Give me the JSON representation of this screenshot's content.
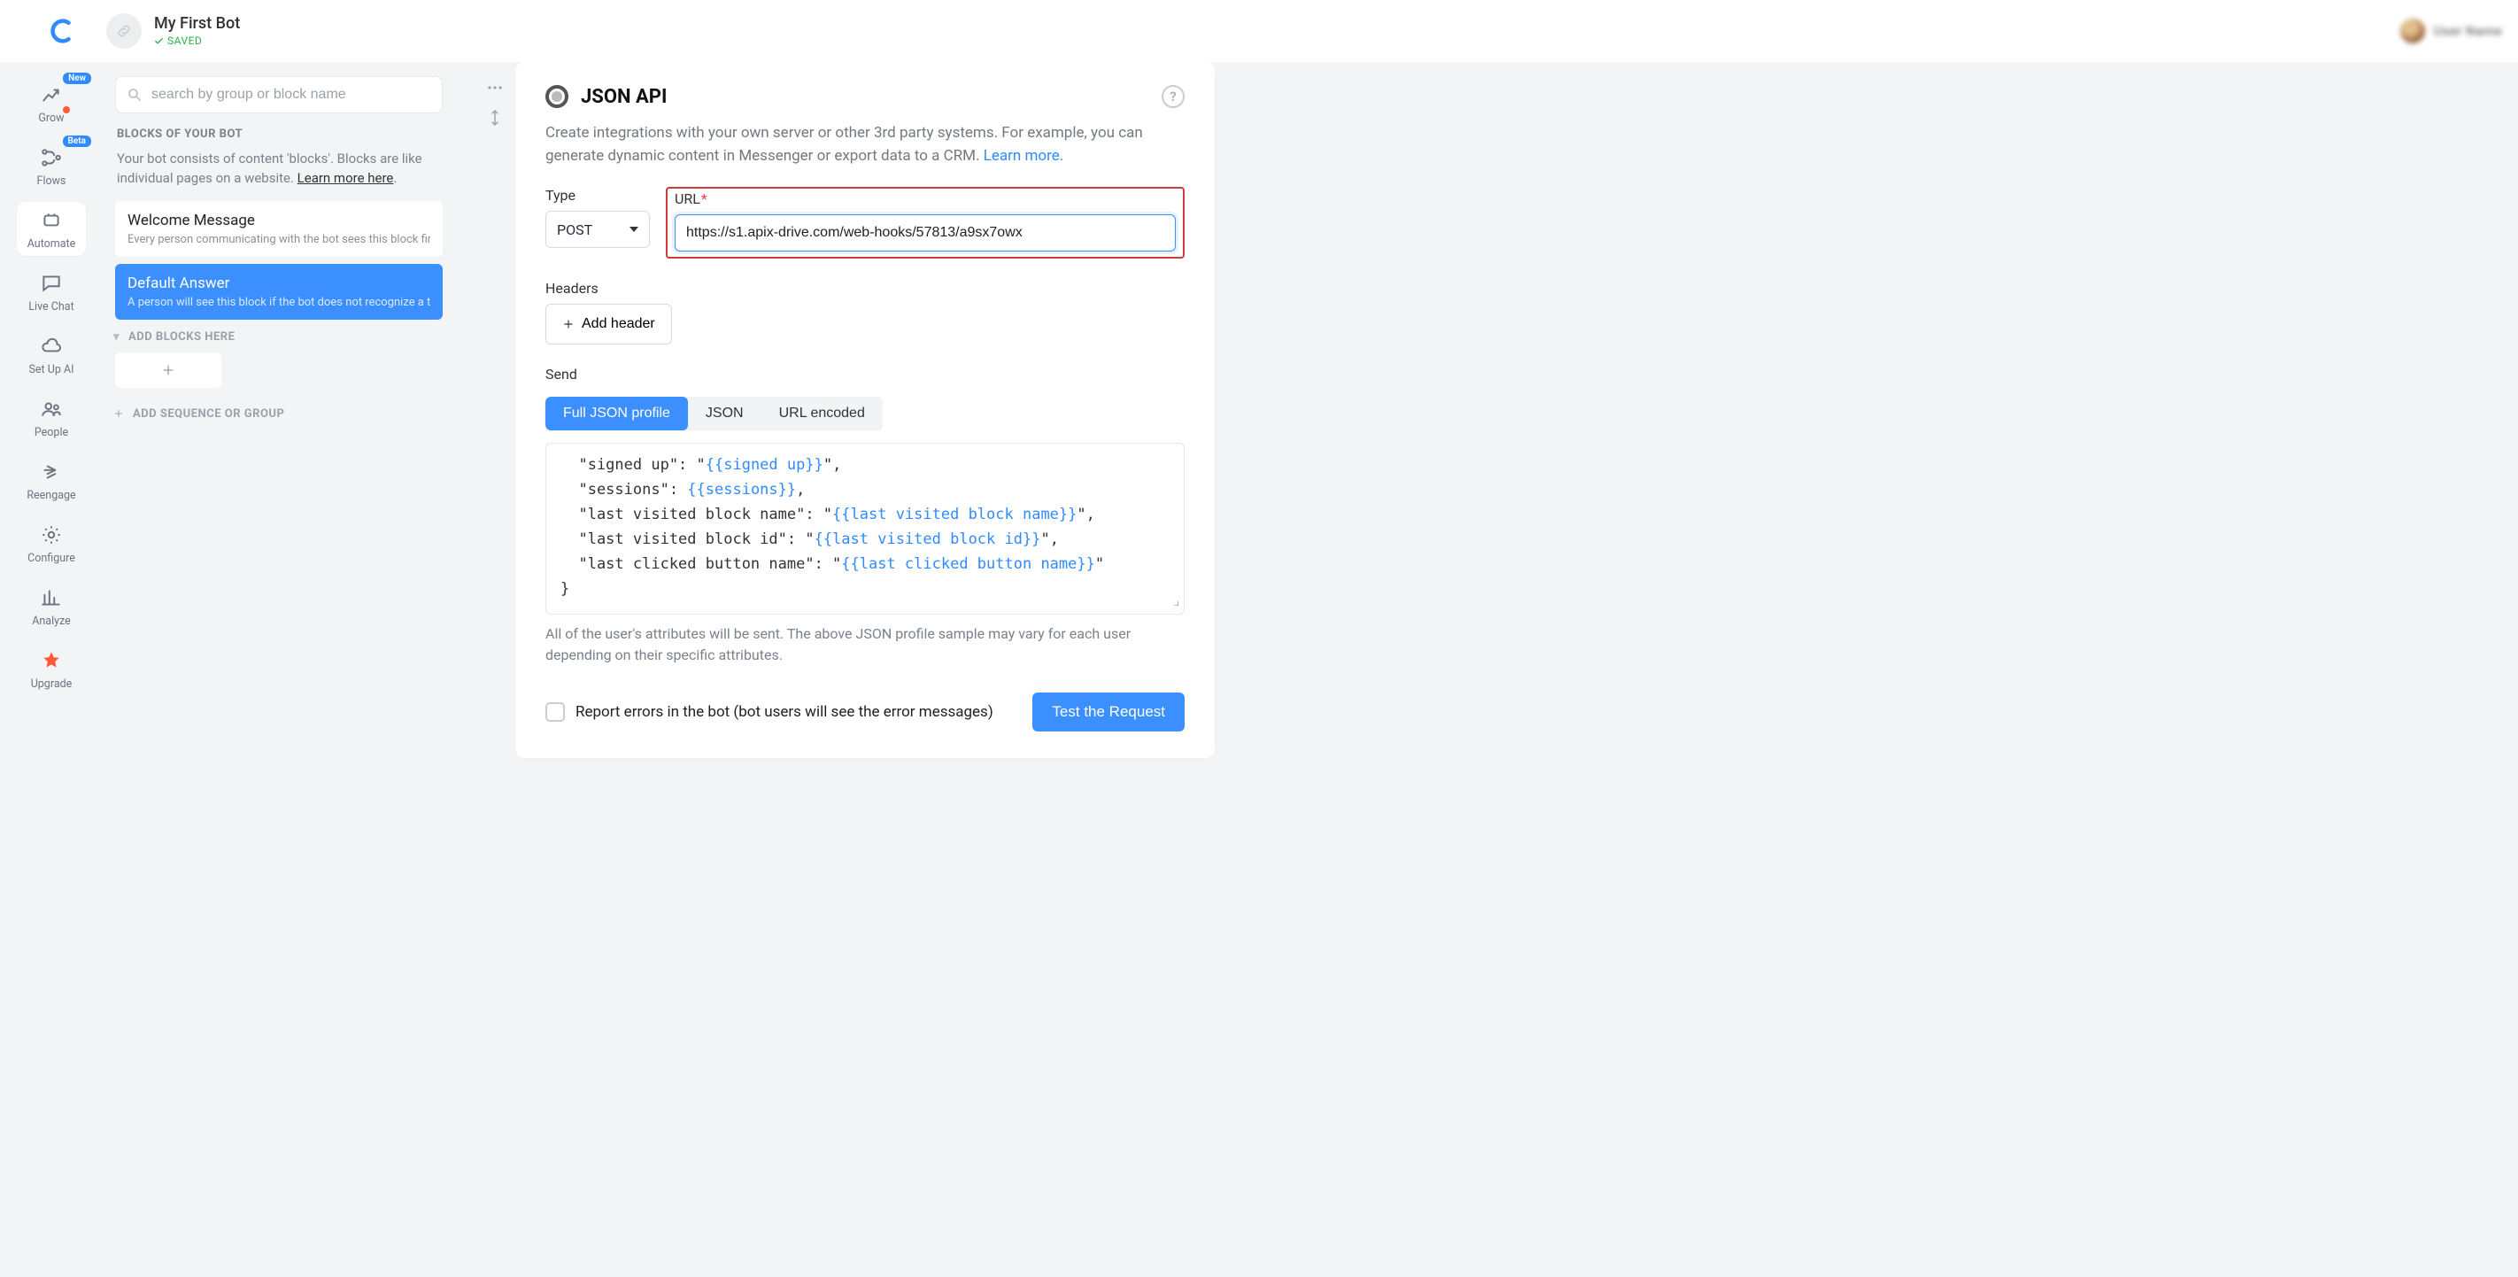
{
  "header": {
    "bot_name": "My First Bot",
    "saved_label": "SAVED",
    "user_name": "User Name"
  },
  "nav": {
    "grow": "Grow",
    "grow_badge": "New",
    "flows": "Flows",
    "flows_badge": "Beta",
    "automate": "Automate",
    "live_chat": "Live Chat",
    "set_up_ai": "Set Up AI",
    "people": "People",
    "reengage": "Reengage",
    "configure": "Configure",
    "analyze": "Analyze",
    "upgrade": "Upgrade"
  },
  "blocks": {
    "search_placeholder": "search by group or block name",
    "heading": "BLOCKS OF YOUR BOT",
    "desc_pre": "Your bot consists of content 'blocks'. Blocks are like individual pages on a website. ",
    "desc_link": "Learn more here",
    "welcome_title": "Welcome Message",
    "welcome_desc": "Every person communicating with the bot sees this block first",
    "default_title": "Default Answer",
    "default_desc": "A person will see this block if the bot does not recognize a text",
    "add_blocks": "ADD BLOCKS HERE",
    "add_sequence": "ADD SEQUENCE OR GROUP"
  },
  "panel": {
    "title": "JSON API",
    "desc": "Create integrations with your own server or other 3rd party systems. For example, you can generate dynamic content in Messenger or export data to a CRM.  ",
    "learn_more": "Learn more.",
    "type_label": "Type",
    "type_value": "POST",
    "url_label": "URL",
    "url_value": "https://s1.apix-drive.com/web-hooks/57813/a9sx7owx",
    "headers_label": "Headers",
    "add_header": "Add header",
    "send_label": "Send",
    "seg_full": "Full JSON profile",
    "seg_json": "JSON",
    "seg_urlenc": "URL encoded",
    "code_lines": [
      {
        "prefix": "  \"signed up\": \"",
        "token": "{{signed up}}",
        "suffix": "\","
      },
      {
        "prefix": "  \"sessions\": ",
        "token": "{{sessions}}",
        "suffix": ","
      },
      {
        "prefix": "  \"last visited block name\": \"",
        "token": "{{last visited block name}}",
        "suffix": "\","
      },
      {
        "prefix": "  \"last visited block id\": \"",
        "token": "{{last visited block id}}",
        "suffix": "\","
      },
      {
        "prefix": "  \"last clicked button name\": \"",
        "token": "{{last clicked button name}}",
        "suffix": "\""
      },
      {
        "prefix": "}",
        "token": "",
        "suffix": ""
      }
    ],
    "hint": "All of the user's attributes will be sent. The above JSON profile sample may vary for each user depending on their specific attributes.",
    "report_errors": "Report errors in the bot (bot users will see the error messages)",
    "test_btn": "Test the Request"
  }
}
